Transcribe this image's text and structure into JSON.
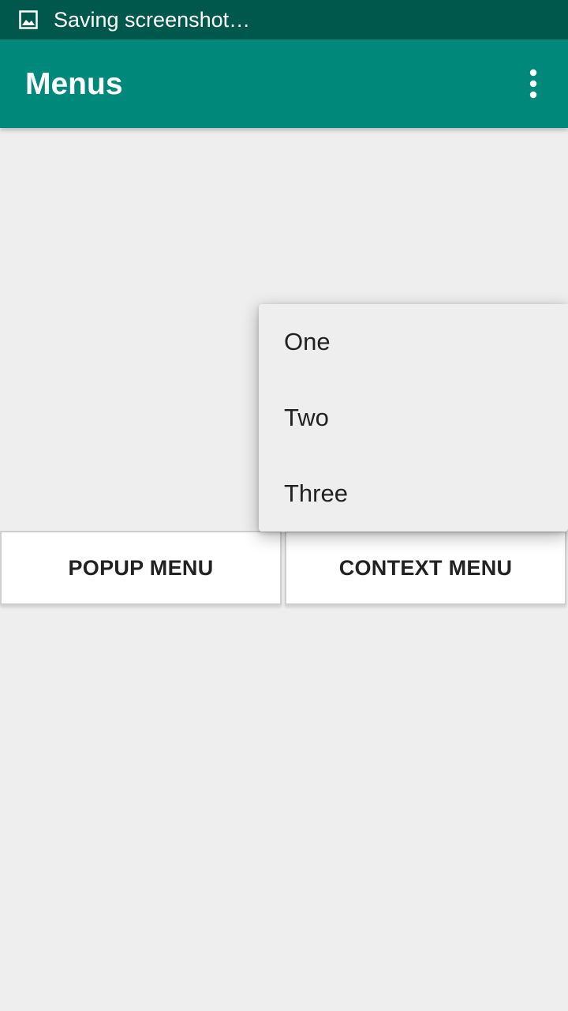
{
  "status_bar": {
    "notification_icon": "image-icon",
    "text": "Saving screenshot…",
    "color": "#00574b"
  },
  "app_bar": {
    "title": "Menus",
    "overflow_icon": "more-vert-icon",
    "color": "#00897b"
  },
  "buttons": {
    "popup_label": "POPUP MENU",
    "context_label": "CONTEXT MENU"
  },
  "popup_menu": {
    "items": [
      {
        "label": "One"
      },
      {
        "label": "Two"
      },
      {
        "label": "Three"
      }
    ]
  }
}
